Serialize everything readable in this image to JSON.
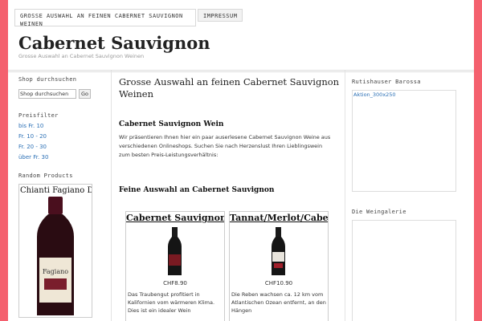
{
  "nav": {
    "tabs": [
      {
        "label": "GROSSE AUSWAHL AN FEINEN CABERNET SAUVIGNON WEINEN"
      },
      {
        "label": "IMPRESSUM"
      }
    ]
  },
  "header": {
    "title": "Cabernet Sauvignon",
    "description": "Grosse Auswahl an Cabernet Sauvignon Weinen"
  },
  "left_sidebar": {
    "search_title": "Shop durchsuchen",
    "search_value": "Shop durchsuchen",
    "search_button": "Go",
    "price_title": "Preisfilter",
    "price_links": [
      "bis Fr. 10",
      "Fr. 10 - 20",
      "Fr. 20 - 30",
      "über Fr. 30"
    ],
    "random_title": "Random Products",
    "random_product_title": "Chianti Fagiano DOCG",
    "random_product_label": "Fagiano"
  },
  "main": {
    "page_title": "Grosse Auswahl an feinen Cabernet Sauvignon Weinen",
    "intro_heading": "Cabernet Sauvignon Wein",
    "intro_text": "Wir präsentieren Ihnen hier ein paar auserlesene Cabernet Sauvignon Weine aus verschiedenen Onlineshops. Suchen Sie nach Herzenslust Ihren Lieblingswein zum besten Preis-Leistungsverhältnis:",
    "section_heading": "Feine Auswahl an Cabernet Sauvignon",
    "products": [
      {
        "title": "Cabernet Sauvignon California",
        "price": "CHF8.90",
        "description": "Das Traubengut profitiert in Kalifornien vom wärmeren Klima. Dies ist ein idealer Wein"
      },
      {
        "title": "Tannat/Merlot/Cabernet Franc, Maldonado",
        "price": "CHF10.90",
        "description": "Die Reben wachsen ca. 12 km vom Atlantischen Ozean entfernt, an den Hängen"
      }
    ]
  },
  "right_sidebar": {
    "widget1_title": "Rutishauser Barossa",
    "widget1_image_link": "Aktion_300x250",
    "widget2_title": "Die Weingalerie"
  }
}
